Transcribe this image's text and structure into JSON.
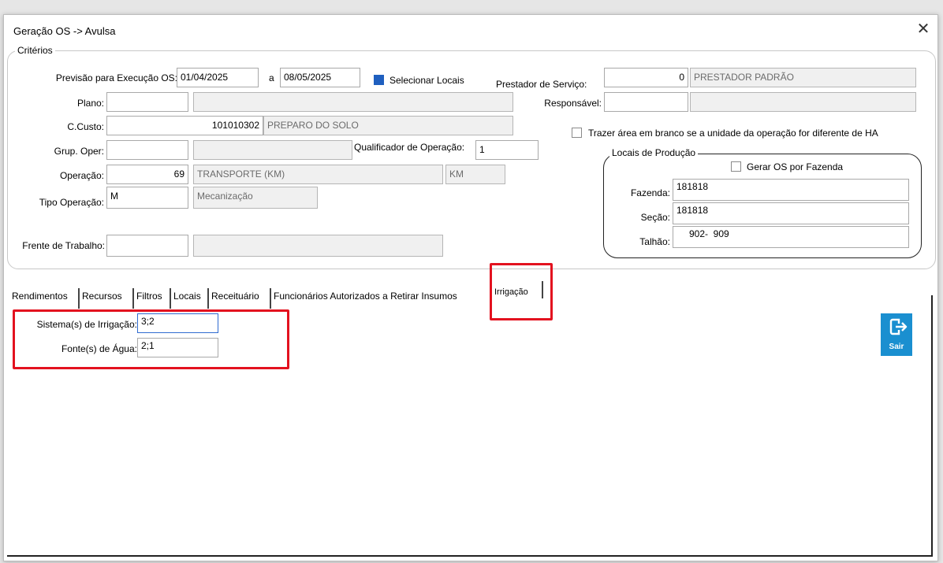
{
  "window": {
    "title": "Geração OS -> Avulsa",
    "close_glyph": "✕"
  },
  "criterios": {
    "title": "Critérios",
    "previsao_label": "Previsão para Execução OS:",
    "date_from": "01/04/2025",
    "a_label": "a",
    "date_to": "08/05/2025",
    "selecionar_locais": "Selecionar Locais",
    "prestador_label": "Prestador de Serviço:",
    "prestador_code": "0",
    "prestador_name": "PRESTADOR PADRÃO",
    "plano_label": "Plano:",
    "plano_value": "",
    "plano_desc": "",
    "responsavel_label": "Responsável:",
    "responsavel_value": "",
    "responsavel_desc": "",
    "ccusto_label": "C.Custo:",
    "ccusto_code": "101010302",
    "ccusto_desc": "PREPARO DO SOLO",
    "trazer_area_label": "Trazer área em branco se a unidade da operação for diferente de HA",
    "grup_oper_label": "Grup. Oper:",
    "grup_oper_value": "",
    "grup_oper_desc": "",
    "qualificador_label": "Qualificador de Operação:",
    "qualificador_value": "1",
    "operacao_label": "Operação:",
    "operacao_code": "69",
    "operacao_desc": "TRANSPORTE (KM)",
    "operacao_unit": "KM",
    "tipo_operacao_label": "Tipo Operação:",
    "tipo_operacao_code": "M",
    "tipo_operacao_desc": "Mecanização",
    "frente_label": "Frente de Trabalho:",
    "frente_value": "",
    "frente_desc": ""
  },
  "locais": {
    "title": "Locais de Produção",
    "gerar_os_label": "Gerar OS por Fazenda",
    "fazenda_label": "Fazenda:",
    "fazenda_value": "181818",
    "secao_label": "Seção:",
    "secao_value": "181818",
    "talhao_label": "Talhão:",
    "talhao_value": "902-  909"
  },
  "tabs": [
    {
      "label": "Rendimentos"
    },
    {
      "label": "Recursos"
    },
    {
      "label": "Filtros"
    },
    {
      "label": "Locais"
    },
    {
      "label": "Receituário"
    },
    {
      "label": "Funcionários Autorizados a Retirar Insumos"
    },
    {
      "label": "Irrigação"
    }
  ],
  "irrigacao": {
    "sistemas_label": "Sistema(s) de Irrigação:",
    "sistemas_value": "3;2",
    "fontes_label": "Fonte(s) de Água:",
    "fontes_value": "2;1"
  },
  "sair": {
    "label": "Sair",
    "color": "#1a8fd0"
  },
  "colors": {
    "highlight": "#e3121f",
    "checkbox_on": "#1f5fbf"
  }
}
